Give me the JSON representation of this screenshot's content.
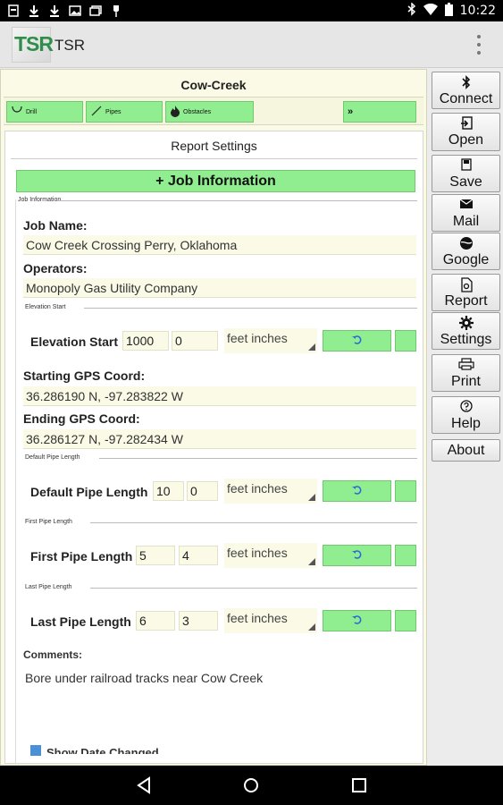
{
  "status_bar": {
    "left_icons": [
      "notification-icon",
      "download-icon",
      "download-icon",
      "photo-icon",
      "photos-icon",
      "pin-icon"
    ],
    "right_icons": [
      "bluetooth-icon",
      "wifi-icon",
      "battery-icon"
    ],
    "time": "10:22"
  },
  "app_bar": {
    "logo_text": "TSR",
    "title": "TSR"
  },
  "project": {
    "title": "Cow-Creek",
    "tabs": [
      {
        "icon": "drill-icon",
        "label": "Drill"
      },
      {
        "icon": "pipes-icon",
        "label": "Pipes"
      },
      {
        "icon": "obstacles-icon",
        "label": "Obstacles"
      },
      {
        "icon": "more-icon",
        "label": "»"
      }
    ]
  },
  "report": {
    "title": "Report Settings",
    "section_button": "+ Job Information",
    "section_caption": "Job Information",
    "job_name_label": "Job Name:",
    "job_name": "Cow Creek Crossing Perry, Oklahoma",
    "operators_label": "Operators:",
    "operators": "Monopoly Gas Utility Company",
    "elevation": {
      "caption": "Elevation Start",
      "label": "Elevation Start",
      "feet": "1000",
      "inches": "0",
      "unit": "feet inches"
    },
    "start_gps_label": "Starting GPS Coord:",
    "start_gps": "36.286190 N, -97.283822 W",
    "end_gps_label": "Ending GPS Coord:",
    "end_gps": "36.286127 N, -97.282434 W",
    "default_pipe": {
      "caption": "Default Pipe Length",
      "label": "Default Pipe Length",
      "feet": "10",
      "inches": "0",
      "unit": "feet inches"
    },
    "first_pipe": {
      "caption": "First Pipe Length",
      "label": "First Pipe Length",
      "feet": "5",
      "inches": "4",
      "unit": "feet inches"
    },
    "last_pipe": {
      "caption": "Last Pipe Length",
      "label": "Last Pipe Length",
      "feet": "6",
      "inches": "3",
      "unit": "feet inches"
    },
    "comments_label": "Comments:",
    "comments": "Bore under railroad tracks near Cow Creek",
    "show_date_changed": "Show Date Changed"
  },
  "side_buttons": [
    {
      "icon": "bluetooth-icon",
      "label": "Connect"
    },
    {
      "icon": "open-icon",
      "label": "Open"
    },
    {
      "icon": "save-icon",
      "label": "Save"
    },
    {
      "icon": "mail-icon",
      "label": "Mail"
    },
    {
      "icon": "globe-icon",
      "label": "Google"
    },
    {
      "icon": "report-icon",
      "label": "Report"
    },
    {
      "icon": "gear-icon",
      "label": "Settings"
    },
    {
      "icon": "print-icon",
      "label": "Print"
    },
    {
      "icon": "help-icon",
      "label": "Help"
    },
    {
      "icon": "",
      "label": "About"
    }
  ],
  "colors": {
    "accent_green": "#90ee90",
    "panel_cream": "#fafae6",
    "logo_green": "#2f8f4a",
    "undo_blue": "#2a6bd8"
  }
}
